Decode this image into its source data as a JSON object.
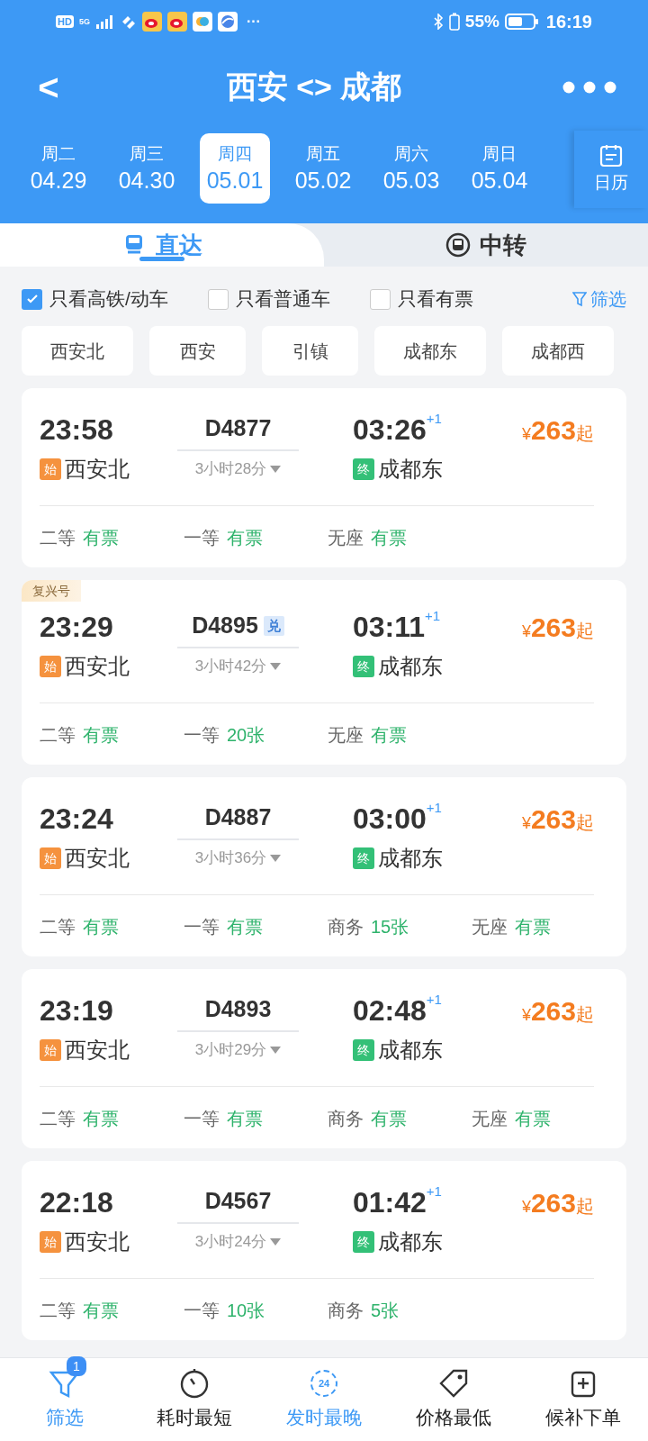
{
  "status_bar": {
    "hd": "HD",
    "network": "5G",
    "more": "···",
    "battery": "55%",
    "time": "16:19"
  },
  "header": {
    "back": "<",
    "title": "西安 <> 成都"
  },
  "dates": [
    {
      "weekday": "周二",
      "date": "04.29",
      "selected": false
    },
    {
      "weekday": "周三",
      "date": "04.30",
      "selected": false
    },
    {
      "weekday": "周四",
      "date": "05.01",
      "selected": true
    },
    {
      "weekday": "周五",
      "date": "05.02",
      "selected": false
    },
    {
      "weekday": "周六",
      "date": "05.03",
      "selected": false
    },
    {
      "weekday": "周日",
      "date": "05.04",
      "selected": false
    }
  ],
  "calendar": {
    "label": "日历"
  },
  "tabs": [
    {
      "label": "直达",
      "kind": "direct",
      "selected": true
    },
    {
      "label": "中转",
      "kind": "transfer",
      "selected": false
    }
  ],
  "filters": [
    {
      "label": "只看高铁/动车",
      "checked": true
    },
    {
      "label": "只看普通车",
      "checked": false
    },
    {
      "label": "只看有票",
      "checked": false
    }
  ],
  "filter_button": {
    "label": "筛选"
  },
  "stations": [
    "西安北",
    "西安",
    "引镇",
    "成都东",
    "成都西"
  ],
  "trains": [
    {
      "depart": "23:58",
      "number": "D4877",
      "duration": "3小时28分",
      "arrive": "03:26",
      "day_offset": "+1",
      "currency": "¥",
      "price": "263",
      "price_suffix": "起",
      "from_tag": "始",
      "from": "西安北",
      "to_tag": "终",
      "to": "成都东",
      "seats": [
        {
          "class": "二等",
          "status": "有票"
        },
        {
          "class": "一等",
          "status": "有票"
        },
        {
          "class": "无座",
          "status": "有票"
        }
      ]
    },
    {
      "badge": "复兴号",
      "depart": "23:29",
      "number": "D4895",
      "exchange": "兑",
      "duration": "3小时42分",
      "arrive": "03:11",
      "day_offset": "+1",
      "currency": "¥",
      "price": "263",
      "price_suffix": "起",
      "from_tag": "始",
      "from": "西安北",
      "to_tag": "终",
      "to": "成都东",
      "seats": [
        {
          "class": "二等",
          "status": "有票"
        },
        {
          "class": "一等",
          "status": "20张"
        },
        {
          "class": "无座",
          "status": "有票"
        }
      ]
    },
    {
      "depart": "23:24",
      "number": "D4887",
      "duration": "3小时36分",
      "arrive": "03:00",
      "day_offset": "+1",
      "currency": "¥",
      "price": "263",
      "price_suffix": "起",
      "from_tag": "始",
      "from": "西安北",
      "to_tag": "终",
      "to": "成都东",
      "seats": [
        {
          "class": "二等",
          "status": "有票"
        },
        {
          "class": "一等",
          "status": "有票"
        },
        {
          "class": "商务",
          "status": "15张"
        },
        {
          "class": "无座",
          "status": "有票"
        }
      ]
    },
    {
      "depart": "23:19",
      "number": "D4893",
      "duration": "3小时29分",
      "arrive": "02:48",
      "day_offset": "+1",
      "currency": "¥",
      "price": "263",
      "price_suffix": "起",
      "from_tag": "始",
      "from": "西安北",
      "to_tag": "终",
      "to": "成都东",
      "seats": [
        {
          "class": "二等",
          "status": "有票"
        },
        {
          "class": "一等",
          "status": "有票"
        },
        {
          "class": "商务",
          "status": "有票"
        },
        {
          "class": "无座",
          "status": "有票"
        }
      ]
    },
    {
      "depart": "22:18",
      "number": "D4567",
      "duration": "3小时24分",
      "arrive": "01:42",
      "day_offset": "+1",
      "currency": "¥",
      "price": "263",
      "price_suffix": "起",
      "from_tag": "始",
      "from": "西安北",
      "to_tag": "终",
      "to": "成都东",
      "seats": [
        {
          "class": "二等",
          "status": "有票"
        },
        {
          "class": "一等",
          "status": "10张"
        },
        {
          "class": "商务",
          "status": "5张"
        }
      ]
    }
  ],
  "bottom_bar": [
    {
      "label": "筛选",
      "kind": "filter",
      "badge": "1",
      "selected": true
    },
    {
      "label": "耗时最短",
      "kind": "timer",
      "selected": false
    },
    {
      "label": "发时最晚",
      "kind": "clock24",
      "icon_text": "24",
      "selected": true
    },
    {
      "label": "价格最低",
      "kind": "price",
      "selected": false
    },
    {
      "label": "候补下单",
      "kind": "waitlist",
      "selected": false
    }
  ]
}
